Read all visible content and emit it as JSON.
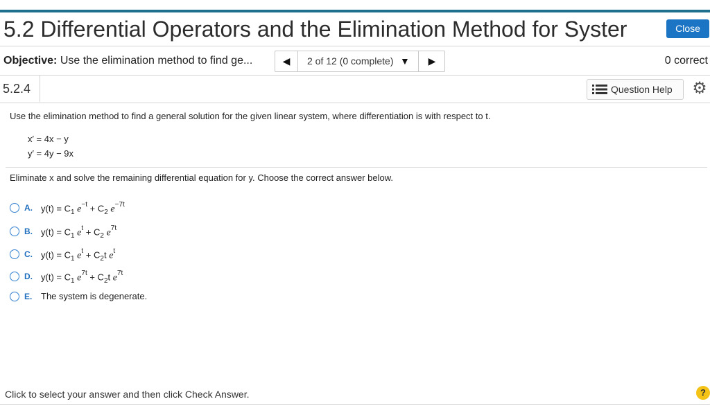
{
  "header": {
    "title": "5.2 Differential Operators and the Elimination Method for Syster",
    "close_label": "Close"
  },
  "objective": {
    "label": "Objective:",
    "text": "Use the elimination method to find ge...",
    "progress": "2 of 12 (0 complete)",
    "prev_symbol": "◀",
    "next_symbol": "▶",
    "dropdown_symbol": "▼",
    "score": "0 correct"
  },
  "question": {
    "number": "5.2.4",
    "help_label": "Question Help",
    "help_icon": "list-icon",
    "settings_icon": "gear-icon"
  },
  "problem": {
    "statement": "Use the elimination method to find a general solution for the given linear system, where differentiation is with respect to t.",
    "eq1": "x′ = 4x − y",
    "eq2": "y′ = 4y − 9x",
    "instruction": "Eliminate x and solve the remaining differential equation for y. Choose the correct answer below."
  },
  "options": [
    {
      "letter": "A.",
      "parts": {
        "a": "y(t) = C",
        "s1": "1",
        "e1": "e",
        "x1": "−t",
        "p": " + C",
        "s2": "2",
        "e2": "e",
        "x2": "−7t"
      }
    },
    {
      "letter": "B.",
      "parts": {
        "a": "y(t) = C",
        "s1": "1",
        "e1": "e",
        "x1": "t",
        "p": " + C",
        "s2": "2",
        "e2": "e",
        "x2": "7t"
      }
    },
    {
      "letter": "C.",
      "parts": {
        "a": "y(t) = C",
        "s1": "1",
        "e1": "e",
        "x1": "t",
        "p": " + C",
        "s2": "2",
        "t": "t",
        "e2": "e",
        "x2": "t"
      }
    },
    {
      "letter": "D.",
      "parts": {
        "a": "y(t) = C",
        "s1": "1",
        "e1": "e",
        "x1": "7t",
        "p": " + C",
        "s2": "2",
        "t": "t",
        "e2": "e",
        "x2": "7t"
      }
    },
    {
      "letter": "E.",
      "text": "The system is degenerate."
    }
  ],
  "footer": {
    "instruction": "Click to select your answer and then click Check Answer.",
    "help_symbol": "?"
  },
  "colors": {
    "accent_bar": "#1e6e8e",
    "close_button": "#1c75c4",
    "option_letter": "#1f6fbf",
    "help_badge": "#f5c216"
  }
}
